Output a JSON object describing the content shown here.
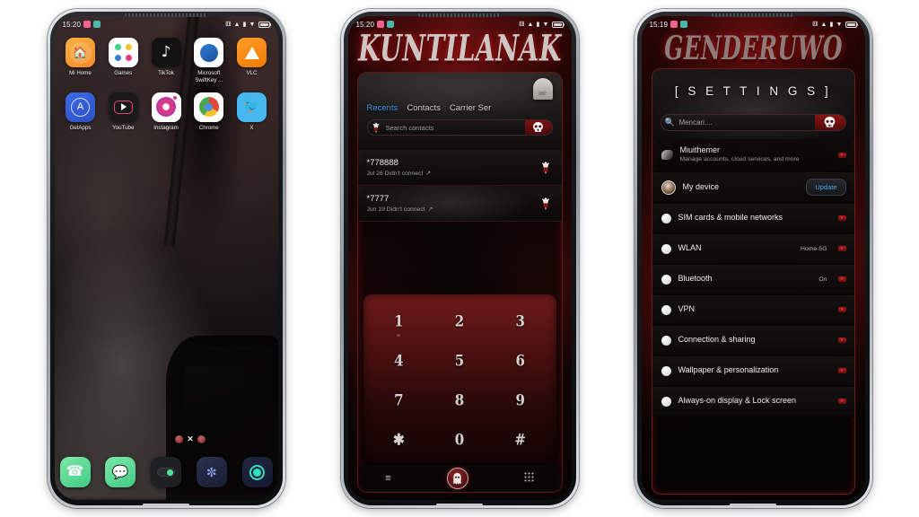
{
  "page": {
    "background": "#ffffff"
  },
  "phones": [
    {
      "id": "home-screen",
      "status": {
        "time": "15:20",
        "icons": [
          "bluetooth-icon",
          "signal-icon",
          "sim-icon",
          "wifi-icon",
          "battery-icon"
        ]
      },
      "apps_row1": [
        {
          "label": "Mi Home",
          "icon": "mi-home-icon"
        },
        {
          "label": "Games",
          "icon": "games-icon"
        },
        {
          "label": "TikTok",
          "icon": "tiktok-icon"
        },
        {
          "label": "Microsoft SwiftKey ...",
          "icon": "swiftkey-icon"
        },
        {
          "label": "VLC",
          "icon": "vlc-icon"
        }
      ],
      "apps_row2": [
        {
          "label": "GetApps",
          "icon": "getapps-icon"
        },
        {
          "label": "YouTube",
          "icon": "youtube-icon"
        },
        {
          "label": "Instagram",
          "icon": "instagram-icon"
        },
        {
          "label": "Chrome",
          "icon": "chrome-icon"
        },
        {
          "label": "X",
          "icon": "x-icon"
        }
      ],
      "page_indicator": {
        "separator": "✕",
        "dots": 2
      },
      "dock": [
        {
          "name": "phone-icon",
          "glyph": "✆"
        },
        {
          "name": "messages-icon",
          "glyph": "…"
        },
        {
          "name": "toggle-widget",
          "glyph": ""
        },
        {
          "name": "gallery-icon",
          "glyph": "❀"
        },
        {
          "name": "camera-icon",
          "glyph": "●"
        }
      ]
    },
    {
      "id": "dialer-screen",
      "status": {
        "time": "15:20"
      },
      "title": "KUNTILANAK",
      "tabs": [
        {
          "label": "Recents",
          "active": true
        },
        {
          "label": "Contacts",
          "active": false
        },
        {
          "label": "Carrier Ser",
          "active": false
        }
      ],
      "search": {
        "placeholder": "Search contacts",
        "left_icon": "ghost-icon",
        "right_icon": "skull-icon"
      },
      "grave_icon_label": "RIP",
      "calls": [
        {
          "number": "*778888",
          "detail": "Jul 26 Didn't connect",
          "arrow": "↗",
          "icon": "ghost-icon"
        },
        {
          "number": "*7777",
          "detail": "Jun 19 Didn't connect",
          "arrow": "↗",
          "icon": "ghost-icon"
        }
      ],
      "keypad": [
        [
          {
            "num": "1",
            "sub": "∞"
          },
          {
            "num": "2",
            "sub": ""
          },
          {
            "num": "3",
            "sub": ""
          }
        ],
        [
          {
            "num": "4",
            "sub": ""
          },
          {
            "num": "5",
            "sub": ""
          },
          {
            "num": "6",
            "sub": ""
          }
        ],
        [
          {
            "num": "7",
            "sub": ""
          },
          {
            "num": "8",
            "sub": ""
          },
          {
            "num": "9",
            "sub": ""
          }
        ],
        [
          {
            "num": "✱",
            "sub": ""
          },
          {
            "num": "0",
            "sub": ""
          },
          {
            "num": "#",
            "sub": ""
          }
        ]
      ],
      "navbar": [
        {
          "name": "menu-icon",
          "glyph": "≡"
        },
        {
          "name": "call-button",
          "glyph": "✆"
        },
        {
          "name": "keypad-icon",
          "glyph": "∷"
        }
      ]
    },
    {
      "id": "settings-screen",
      "status": {
        "time": "15:19"
      },
      "title": "GENDERUWO",
      "header": "[ S E T T I N G S ]",
      "search": {
        "placeholder": "Mencari....",
        "left_icon": "search-icon",
        "right_icon": "skull-icon"
      },
      "items": [
        {
          "label": "Miuithemer",
          "sub": "Manage accounts, cloud services, and more",
          "value": "",
          "icon": "smudge-icon",
          "action": "chevron",
          "dim": true
        },
        {
          "label": "My device",
          "sub": "",
          "value": "",
          "icon": "avatar-icon",
          "action": "update",
          "action_label": "Update",
          "dim": false
        },
        {
          "label": "SIM cards & mobile networks",
          "sub": "",
          "value": "",
          "icon": "bullet-icon",
          "action": "chevron",
          "dim": false
        },
        {
          "label": "WLAN",
          "sub": "",
          "value": "Home-5G",
          "icon": "bullet-icon",
          "action": "chevron",
          "dim": false
        },
        {
          "label": "Bluetooth",
          "sub": "",
          "value": "On",
          "icon": "bullet-icon",
          "action": "chevron",
          "dim": false
        },
        {
          "label": "VPN",
          "sub": "",
          "value": "",
          "icon": "bullet-icon",
          "action": "chevron",
          "dim": false
        },
        {
          "label": "Connection & sharing",
          "sub": "",
          "value": "",
          "icon": "bullet-icon",
          "action": "chevron",
          "dim": false
        },
        {
          "label": "Wallpaper & personalization",
          "sub": "",
          "value": "",
          "icon": "bullet-icon",
          "action": "chevron",
          "dim": false
        },
        {
          "label": "Always-on display & Lock screen",
          "sub": "",
          "value": "",
          "icon": "bullet-icon",
          "action": "chevron",
          "dim": false
        }
      ]
    }
  ]
}
